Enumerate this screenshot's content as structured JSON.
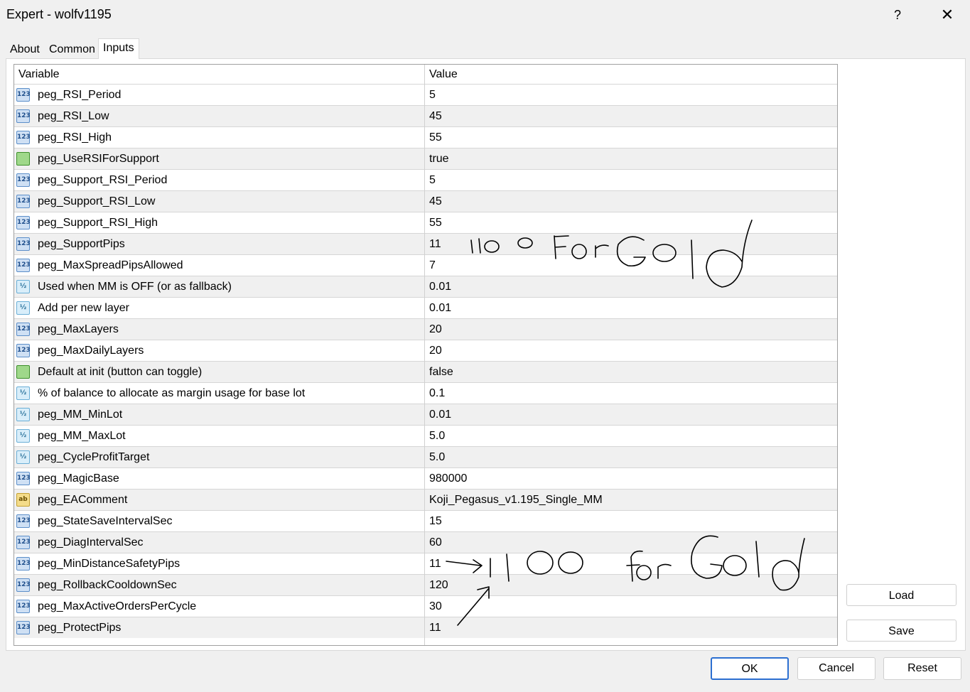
{
  "window": {
    "title": "Expert - wolfv1195",
    "help_label": "?",
    "close_label": "✕"
  },
  "tabs": [
    {
      "label": "About"
    },
    {
      "label": "Common"
    },
    {
      "label": "Inputs"
    }
  ],
  "grid": {
    "headers": {
      "variable": "Variable",
      "value": "Value"
    },
    "rows": [
      {
        "icon": "int-icon",
        "type": "int",
        "badge": "123",
        "name": "peg_RSI_Period",
        "value": "5"
      },
      {
        "icon": "int-icon",
        "type": "int",
        "badge": "123",
        "name": "peg_RSI_Low",
        "value": "45"
      },
      {
        "icon": "int-icon",
        "type": "int",
        "badge": "123",
        "name": "peg_RSI_High",
        "value": "55"
      },
      {
        "icon": "bool-icon",
        "type": "bool",
        "badge": "",
        "name": "peg_UseRSIForSupport",
        "value": "true"
      },
      {
        "icon": "int-icon",
        "type": "int",
        "badge": "123",
        "name": "peg_Support_RSI_Period",
        "value": "5"
      },
      {
        "icon": "int-icon",
        "type": "int",
        "badge": "123",
        "name": "peg_Support_RSI_Low",
        "value": "45"
      },
      {
        "icon": "int-icon",
        "type": "int",
        "badge": "123",
        "name": "peg_Support_RSI_High",
        "value": "55"
      },
      {
        "icon": "int-icon",
        "type": "int",
        "badge": "123",
        "name": "peg_SupportPips",
        "value": "11"
      },
      {
        "icon": "int-icon",
        "type": "int",
        "badge": "123",
        "name": "peg_MaxSpreadPipsAllowed",
        "value": "7"
      },
      {
        "icon": "double-icon",
        "type": "dbl",
        "badge": "½",
        "name": "Used when MM is OFF (or as fallback)",
        "value": "0.01"
      },
      {
        "icon": "double-icon",
        "type": "dbl",
        "badge": "½",
        "name": "Add per new layer",
        "value": "0.01"
      },
      {
        "icon": "int-icon",
        "type": "int",
        "badge": "123",
        "name": "peg_MaxLayers",
        "value": "20"
      },
      {
        "icon": "int-icon",
        "type": "int",
        "badge": "123",
        "name": "peg_MaxDailyLayers",
        "value": "20"
      },
      {
        "icon": "bool-icon",
        "type": "bool",
        "badge": "",
        "name": "Default at init (button can toggle)",
        "value": "false"
      },
      {
        "icon": "double-icon",
        "type": "dbl",
        "badge": "½",
        "name": "% of balance to allocate as margin usage for base lot",
        "value": "0.1"
      },
      {
        "icon": "double-icon",
        "type": "dbl",
        "badge": "½",
        "name": "peg_MM_MinLot",
        "value": "0.01"
      },
      {
        "icon": "double-icon",
        "type": "dbl",
        "badge": "½",
        "name": "peg_MM_MaxLot",
        "value": "5.0"
      },
      {
        "icon": "double-icon",
        "type": "dbl",
        "badge": "½",
        "name": "peg_CycleProfitTarget",
        "value": "5.0"
      },
      {
        "icon": "int-icon",
        "type": "int",
        "badge": "123",
        "name": "peg_MagicBase",
        "value": "980000"
      },
      {
        "icon": "string-icon",
        "type": "str",
        "badge": "ab",
        "name": "peg_EAComment",
        "value": "Koji_Pegasus_v1.195_Single_MM"
      },
      {
        "icon": "int-icon",
        "type": "int",
        "badge": "123",
        "name": "peg_StateSaveIntervalSec",
        "value": "15"
      },
      {
        "icon": "int-icon",
        "type": "int",
        "badge": "123",
        "name": "peg_DiagIntervalSec",
        "value": "60"
      },
      {
        "icon": "int-icon",
        "type": "int",
        "badge": "123",
        "name": "peg_MinDistanceSafetyPips",
        "value": "11"
      },
      {
        "icon": "int-icon",
        "type": "int",
        "badge": "123",
        "name": "peg_RollbackCooldownSec",
        "value": "120"
      },
      {
        "icon": "int-icon",
        "type": "int",
        "badge": "123",
        "name": "peg_MaxActiveOrdersPerCycle",
        "value": "30"
      },
      {
        "icon": "int-icon",
        "type": "int",
        "badge": "123",
        "name": "peg_ProtectPips",
        "value": "11"
      }
    ]
  },
  "side_buttons": {
    "load": "Load",
    "save": "Save"
  },
  "bottom_buttons": {
    "ok": "OK",
    "cancel": "Cancel",
    "reset": "Reset"
  },
  "annotations": {
    "note_1": "1100 ForGold",
    "note_2": "1100 forGold",
    "ink_color": "#000000"
  }
}
